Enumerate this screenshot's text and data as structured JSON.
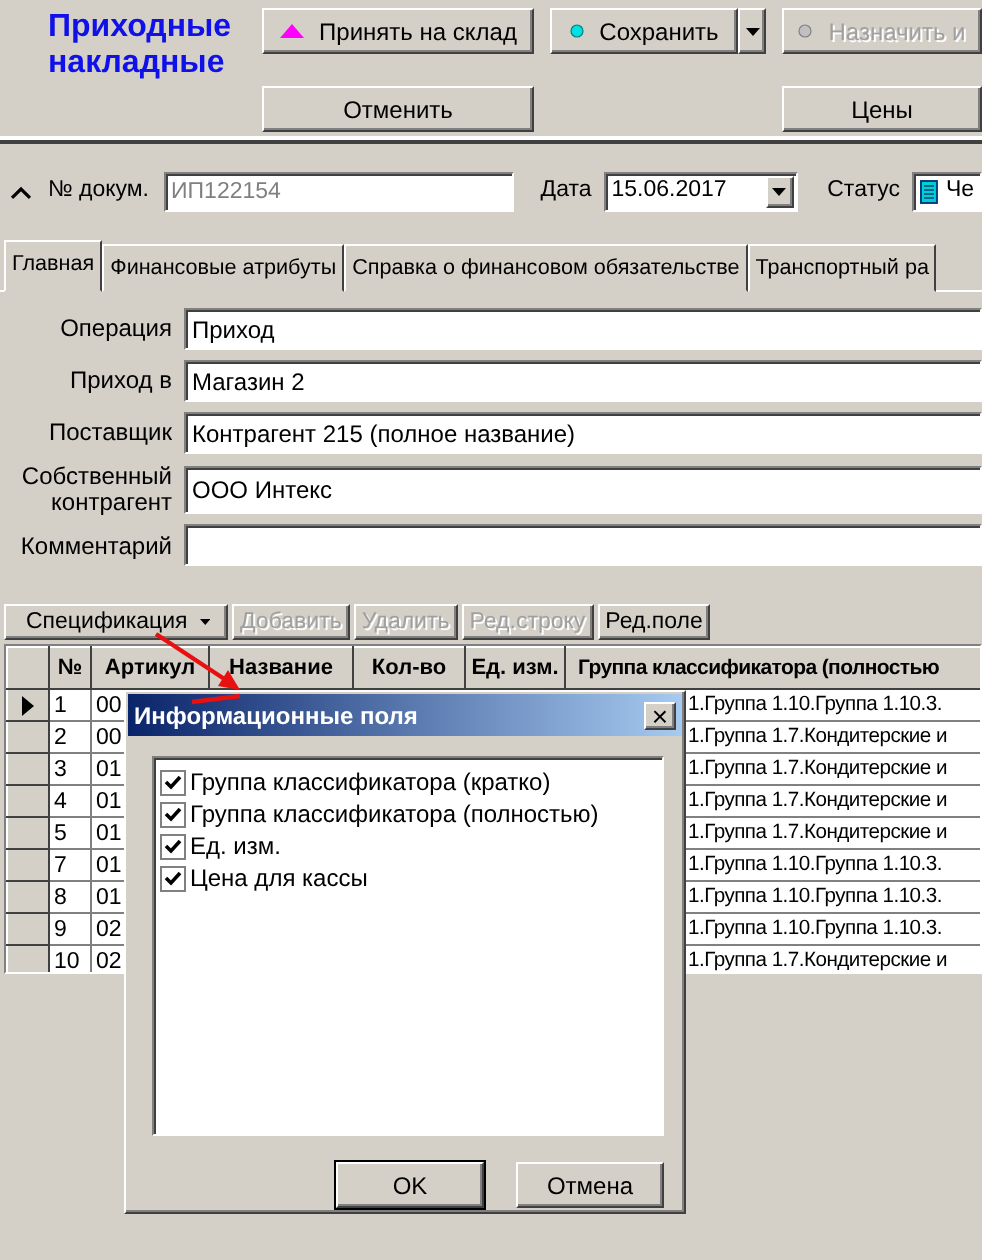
{
  "title": "Приходные накладные",
  "toolbar_top": [
    {
      "label": "Принять на склад",
      "dropdown": false,
      "disabled": false
    },
    {
      "label": "Сохранить",
      "dropdown": true,
      "disabled": false
    },
    {
      "label": "Назначить и",
      "dropdown": false,
      "disabled": true
    }
  ],
  "toolbar_bottom": [
    {
      "label": "Отменить"
    },
    {
      "label": "Цены"
    }
  ],
  "doc": {
    "number_label": "№ докум.",
    "number": "ИП122154",
    "number_disabled": true,
    "date_label": "Дата",
    "date": "15.06.2017",
    "status_label": "Статус",
    "status": "Че"
  },
  "tabs": [
    {
      "label": "Главная",
      "selected": true
    },
    {
      "label": "Финансовые атрибуты",
      "selected": false
    },
    {
      "label": "Справка о финансовом обязательстве",
      "selected": false
    },
    {
      "label": "Транспортный ра",
      "selected": false
    }
  ],
  "fields": [
    {
      "label": "Операция",
      "value": "Приход"
    },
    {
      "label": "Приход в",
      "value": "Магазин 2"
    },
    {
      "label": "Поставщик",
      "value": "Контрагент 215 (полное название)"
    },
    {
      "label": "Собственный контрагент",
      "value": "ООО Интекс"
    },
    {
      "label": "Комментарий"
    }
  ],
  "spec_toolbar": [
    {
      "label": "Спецификация",
      "dropdown": true,
      "disabled": false
    },
    {
      "label": "Добавить",
      "dropdown": false,
      "disabled": true
    },
    {
      "label": "Удалить",
      "dropdown": false,
      "disabled": true
    },
    {
      "label": "Ред.строку",
      "dropdown": false,
      "disabled": true
    },
    {
      "label": "Ред.поле",
      "dropdown": false,
      "disabled": false
    }
  ],
  "grid": {
    "columns": [
      "№",
      "Артикул",
      "Название",
      "Кол-во",
      "Ед. изм.",
      "Группа классификатора (полностью"
    ],
    "rows": [
      {
        "selected": true,
        "number": "1",
        "article": "00",
        "group": "1.Группа 1.10.Группа 1.10.3."
      },
      {
        "selected": false,
        "number": "2",
        "article": "00",
        "group": "1.Группа 1.7.Кондитерские и"
      },
      {
        "selected": false,
        "number": "3",
        "article": "01",
        "group": "1.Группа 1.7.Кондитерские и"
      },
      {
        "selected": false,
        "number": "4",
        "article": "01",
        "group": "1.Группа 1.7.Кондитерские и"
      },
      {
        "selected": false,
        "number": "5",
        "article": "01",
        "group": "1.Группа 1.7.Кондитерские и"
      },
      {
        "selected": false,
        "number": "7",
        "article": "01",
        "group": "1.Группа 1.10.Группа 1.10.3."
      },
      {
        "selected": false,
        "number": "8",
        "article": "01",
        "group": "1.Группа 1.10.Группа 1.10.3."
      },
      {
        "selected": false,
        "number": "9",
        "article": "02",
        "group": "1.Группа 1.10.Группа 1.10.3."
      },
      {
        "selected": false,
        "number": "10",
        "article": "02",
        "group": "1.Группа 1.7.Кондитерские и"
      }
    ]
  },
  "dialog": {
    "title": "Информационные поля",
    "close": "×",
    "items": [
      {
        "label": "Группа классификатора (кратко)",
        "checked": true
      },
      {
        "label": "Группа классификатора (полностью)",
        "checked": true
      },
      {
        "label": "Ед. изм.",
        "checked": true
      },
      {
        "label": "Цена для кассы",
        "checked": true
      }
    ],
    "buttons": [
      {
        "label": "OK",
        "default": true
      },
      {
        "label": "Отмена",
        "default": false
      }
    ]
  }
}
